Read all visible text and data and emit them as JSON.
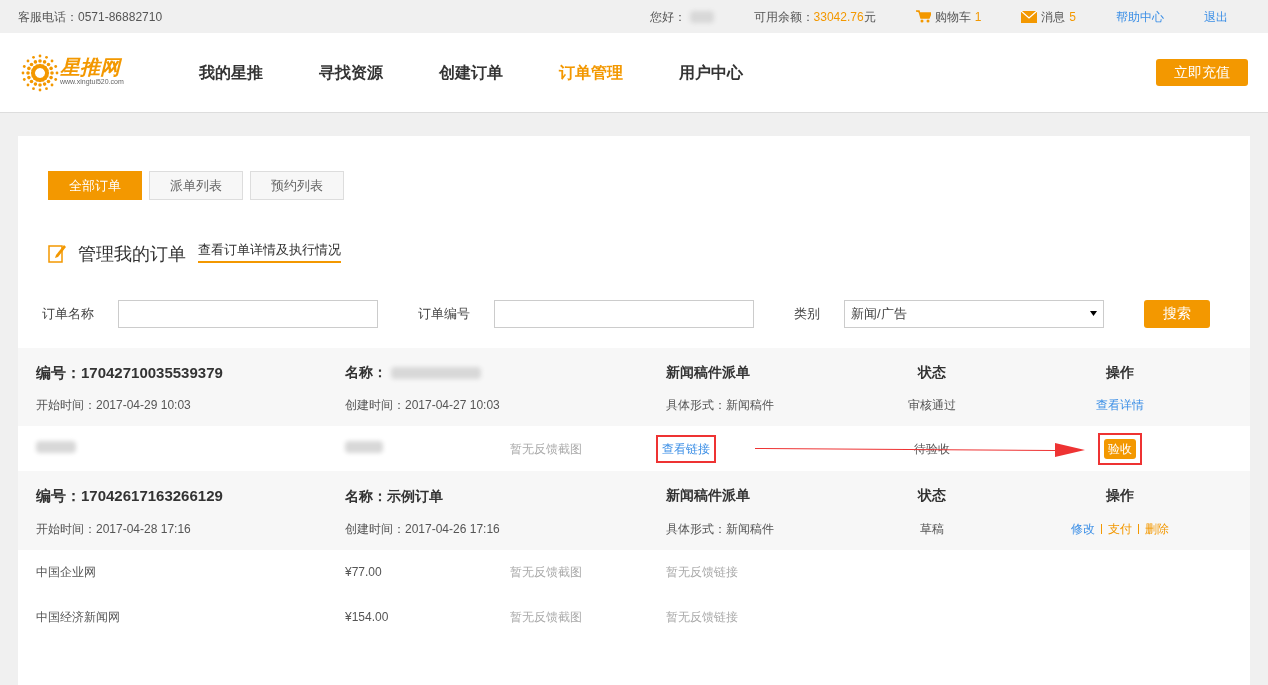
{
  "topbar": {
    "phone": "客服电话：0571-86882710",
    "greeting": "您好：",
    "balance_label": "可用余额：",
    "balance": "33042.76",
    "balance_unit": "元",
    "cart": {
      "label": "购物车",
      "count": "1"
    },
    "messages": {
      "label": "消息",
      "count": "5"
    },
    "help": "帮助中心",
    "logout": "退出"
  },
  "logo": {
    "name": "星推网",
    "url": "www.xingtui520.com"
  },
  "nav": [
    {
      "label": "我的星推",
      "selected": false
    },
    {
      "label": "寻找资源",
      "selected": false
    },
    {
      "label": "创建订单",
      "selected": false
    },
    {
      "label": "订单管理",
      "selected": true
    },
    {
      "label": "用户中心",
      "selected": false
    }
  ],
  "recharge_button": "立即充值",
  "tabs": [
    {
      "label": "全部订单",
      "selected": true
    },
    {
      "label": "派单列表",
      "selected": false
    },
    {
      "label": "预约列表",
      "selected": false
    }
  ],
  "section": {
    "title": "管理我的订单",
    "link": "查看订单详情及执行情况"
  },
  "filters": {
    "name_label": "订单名称",
    "number_label": "订单编号",
    "category_label": "类别",
    "category_value": "新闻/广告",
    "search_button": "搜索"
  },
  "orders": [
    {
      "number": "编号：17042710035539379",
      "name": "名称：",
      "type": "新闻稿件派单",
      "status_heading": "状态",
      "ops_heading": "操作",
      "start": "开始时间：2017-04-29 10:03",
      "created": "创建时间：2017-04-27 10:03",
      "form": "具体形式：新闻稿件",
      "status": "审核通过",
      "actions": [
        {
          "label": "查看详情",
          "kind": "link"
        }
      ],
      "items": [
        {
          "screenshot": "暂无反馈截图",
          "link": {
            "label": "查看链接",
            "kind": "link",
            "highlighted": true
          },
          "status": "待验收",
          "action": {
            "label": "验收",
            "highlighted": true
          },
          "arrow": true
        }
      ]
    },
    {
      "number": "编号：17042617163266129",
      "name": "名称：示例订单",
      "type": "新闻稿件派单",
      "status_heading": "状态",
      "ops_heading": "操作",
      "start": "开始时间：2017-04-28 17:16",
      "created": "创建时间：2017-04-26 17:16",
      "form": "具体形式：新闻稿件",
      "status": "草稿",
      "actions": [
        {
          "label": "修改",
          "kind": "link"
        },
        {
          "label": "支付",
          "kind": "warn"
        },
        {
          "label": "删除",
          "kind": "warn"
        }
      ],
      "items": [
        {
          "media": "中国企业网",
          "price": "¥77.00",
          "screenshot": "暂无反馈截图",
          "link": {
            "label": "暂无反馈链接",
            "kind": "none",
            "highlighted": false
          }
        },
        {
          "media": "中国经济新闻网",
          "price": "¥154.00",
          "screenshot": "暂无反馈截图",
          "link": {
            "label": "暂无反馈链接",
            "kind": "none",
            "highlighted": false
          }
        }
      ]
    }
  ]
}
